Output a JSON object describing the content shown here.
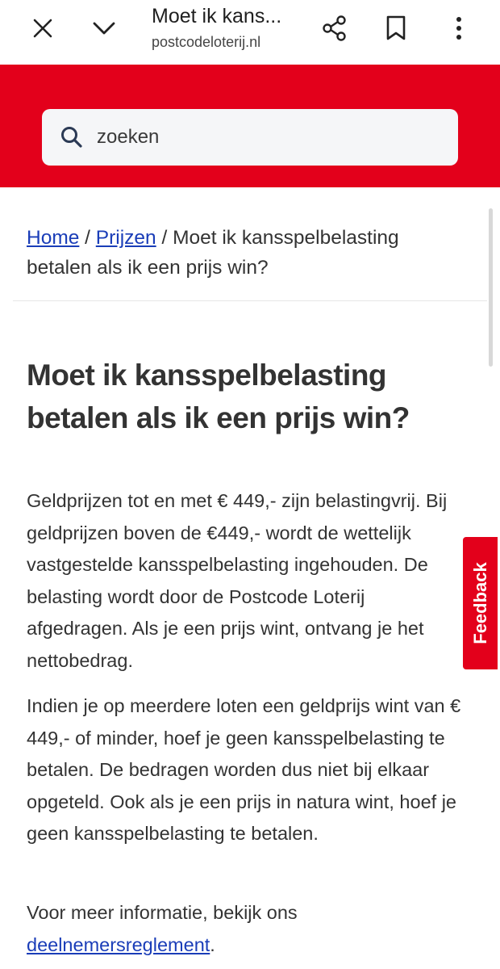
{
  "browser": {
    "tab_title": "Moet ik kans...",
    "url": "postcodeloterij.nl",
    "icons": [
      "close-icon",
      "chevron-down-icon",
      "share-icon",
      "bookmark-icon",
      "more-vert-icon"
    ]
  },
  "header": {
    "background": "#e3001b",
    "search_placeholder": "zoeken"
  },
  "breadcrumb": {
    "home": "Home",
    "sep1": " / ",
    "prizes": "Prijzen",
    "sep2": " / ",
    "current": "Moet ik kansspelbelasting betalen als ik een prijs win?"
  },
  "article": {
    "title": "Moet ik kansspelbelasting betalen als ik een prijs win?",
    "paragraphs": [
      "Geldprijzen tot en met € 449,- zijn belastingvrij. Bij geldprijzen boven de €449,- wordt de wettelijk vastgestelde kansspelbelasting ingehouden. De belasting wordt door de Postcode Loterij afgedragen. Als je een prijs wint, ontvang je het nettobedrag.",
      "Indien je op meerdere loten een geldprijs wint van € 449,- of minder, hoef je geen kansspelbelasting te betalen. De bedragen worden dus niet bij elkaar opgeteld. Ook als je een prijs in natura wint, hoef je geen kansspelbelasting te betalen."
    ],
    "more_info_text": "Voor meer informatie, bekijk ons ",
    "more_info_link": "deelnemersreglement",
    "more_info_end": "."
  },
  "feedback_label": "Feedback",
  "colors": {
    "brand_red": "#e3001b",
    "link_blue": "#1a3db8",
    "text": "#333333"
  }
}
